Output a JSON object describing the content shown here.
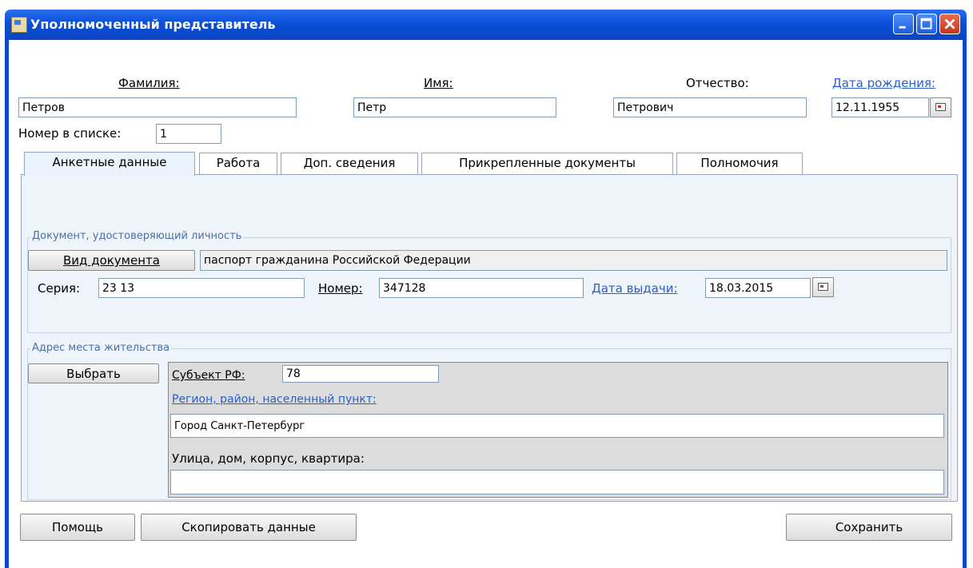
{
  "window": {
    "title": "Уполномоченный представитель",
    "icons": {
      "app": "window-app-icon",
      "minimize": "minimize-icon",
      "maximize": "maximize-icon",
      "close": "close-icon"
    },
    "colors": {
      "titlebar": "#0a4fd6",
      "close_button": "#c4371c"
    }
  },
  "person": {
    "surname_label": "Фамилия:",
    "surname_value": "Петров",
    "name_label": "Имя:",
    "name_value": "Петр",
    "patronymic_label": "Отчество:",
    "patronymic_value": "Петрович",
    "birthdate_label": "Дата рождения:",
    "birthdate_value": "12.11.1955",
    "list_number_label": "Номер в списке:",
    "list_number_value": "1"
  },
  "tabs": [
    {
      "label": "Анкетные данные",
      "active": true
    },
    {
      "label": "Работа",
      "active": false
    },
    {
      "label": "Доп. сведения",
      "active": false
    },
    {
      "label": "Прикрепленные документы",
      "active": false
    },
    {
      "label": "Полномочия",
      "active": false
    }
  ],
  "identity_doc": {
    "group_title": "Документ, удостоверяющий личность",
    "doc_type_button": "Вид документа",
    "doc_type_value": "паспорт гражданина Российской Федерации",
    "series_label": "Серия:",
    "series_value": "23 13",
    "number_label": "Номер:",
    "number_value": "347128",
    "issue_date_label": "Дата выдачи:",
    "issue_date_value": "18.03.2015"
  },
  "address": {
    "group_title": "Адрес места жительства",
    "select_button": "Выбрать",
    "subject_label": "Субъект РФ:",
    "subject_value": "78",
    "region_label": "Регион, район, населенный пункт:",
    "region_value": "Город Санкт-Петербург",
    "street_label": "Улица, дом, корпус, квартира:",
    "street_value": ""
  },
  "footer": {
    "help_button": "Помощь",
    "copy_button": "Скопировать данные",
    "save_button": "Сохранить"
  }
}
